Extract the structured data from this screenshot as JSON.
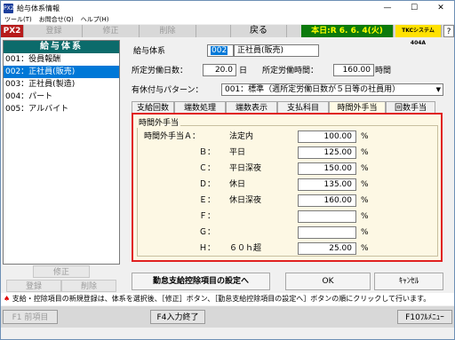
{
  "window": {
    "title": "給与体系情報",
    "icon_text": "PX2",
    "controls": [
      "—",
      "☐",
      "✕"
    ]
  },
  "menu": [
    "ツール(T)",
    "お問合せ(Q)",
    "ヘルプ(H)"
  ],
  "toolbar": {
    "px2": "PX2",
    "register": "登録",
    "modify": "修正",
    "delete": "削除",
    "back": "戻る",
    "date": "本日:R 6. 6. 4(火)",
    "tkc": "TKCシステム404A",
    "help": "?"
  },
  "left_panel": {
    "header": "給与体系",
    "items": [
      {
        "label": "001：役員報酬"
      },
      {
        "label": "002：正社員(販売)"
      },
      {
        "label": "003：正社員(製造)"
      },
      {
        "label": "004：パート"
      },
      {
        "label": "005：アルバイト"
      }
    ],
    "modify": "修正",
    "register": "登録",
    "delete": "削除"
  },
  "form": {
    "system_label": "給与体系",
    "system_code": "002",
    "system_name": "正社員(販売)",
    "days_label": "所定労働日数：",
    "days_value": "20.0",
    "days_unit": "日",
    "hours_label": "所定労働時間：",
    "hours_value": "160.00",
    "hours_unit": "時間",
    "leave_label": "有休付与パターン：",
    "leave_value": "001：標準（週所定労働日数が５日等の社員用）"
  },
  "tabs": [
    "支給回数",
    "端数処理",
    "端数表示",
    "支払科目",
    "時間外手当",
    "回数手当"
  ],
  "overtime": {
    "group_title": "時間外手当",
    "prefix": "時間外手当Ａ：",
    "rows": [
      {
        "key": "Ａ",
        "name": "法定内",
        "value": "100.00",
        "unit": "%"
      },
      {
        "key": "Ｂ：",
        "name": "平日",
        "value": "125.00",
        "unit": "%"
      },
      {
        "key": "Ｃ：",
        "name": "平日深夜",
        "value": "150.00",
        "unit": "%"
      },
      {
        "key": "Ｄ：",
        "name": "休日",
        "value": "135.00",
        "unit": "%"
      },
      {
        "key": "Ｅ：",
        "name": "休日深夜",
        "value": "160.00",
        "unit": "%"
      },
      {
        "key": "Ｆ：",
        "name": "",
        "value": "",
        "unit": "%"
      },
      {
        "key": "Ｇ：",
        "name": "",
        "value": "",
        "unit": "%"
      },
      {
        "key": "Ｈ：",
        "name": "６０ｈ超",
        "value": "25.00",
        "unit": "%"
      }
    ]
  },
  "buttons": {
    "deduction": "勤怠支給控除項目の設定へ",
    "ok": "OK",
    "cancel": "ｷｬﾝｾﾙ"
  },
  "status": {
    "mark": "♠",
    "text": "支給・控除項目の新規登録は、体系を選択後、［修正］ボタン、［勤怠支給控除項目の設定へ］ボタンの順にクリックして行います。"
  },
  "fkeys": {
    "f1": "F1 前項目",
    "f4": "F4入力終了",
    "f10": "F10ﾌﾙﾒﾆｭｰ"
  }
}
